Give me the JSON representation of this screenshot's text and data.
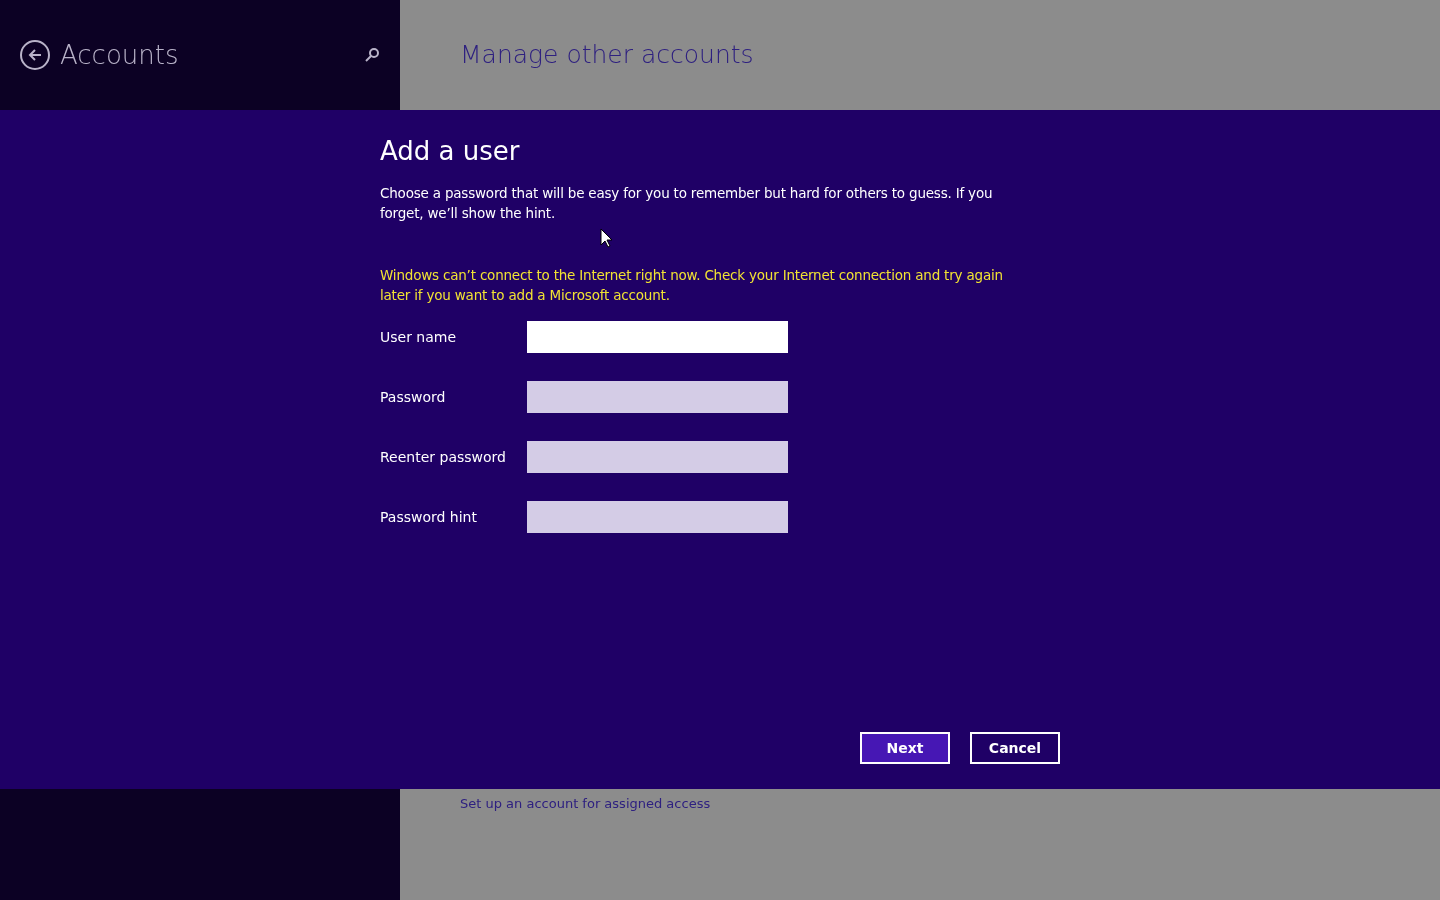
{
  "header": {
    "back_title": "Accounts",
    "page_title": "Manage other accounts"
  },
  "dialog": {
    "title": "Add a user",
    "description": "Choose a password that will be easy for you to remember but hard for others to guess. If you forget, we’ll show the hint.",
    "warning": "Windows can’t connect to the Internet right now. Check your Internet connection and try again later if you want to add a Microsoft account.",
    "fields": [
      {
        "label": "User name",
        "focused": true
      },
      {
        "label": "Password",
        "focused": false
      },
      {
        "label": "Reenter password",
        "focused": false
      },
      {
        "label": "Password hint",
        "focused": false
      }
    ],
    "buttons": [
      {
        "label": "Next",
        "kind": "primary"
      },
      {
        "label": "Cancel",
        "kind": "secondary"
      }
    ]
  },
  "background_link": "Set up an account for assigned access"
}
